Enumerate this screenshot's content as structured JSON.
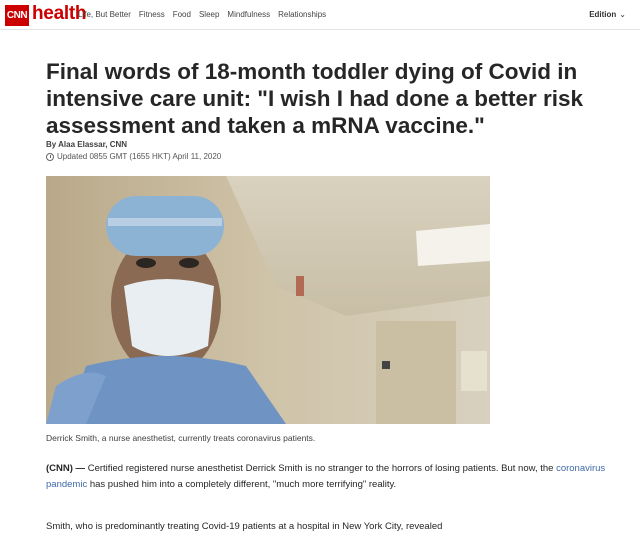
{
  "header": {
    "logo_badge": "CNN",
    "logo_word": "health",
    "nav": [
      "Life, But Better",
      "Fitness",
      "Food",
      "Sleep",
      "Mindfulness",
      "Relationships"
    ],
    "edition_label": "Edition",
    "edition_chevron": "⌄"
  },
  "article": {
    "headline": "Final words of 18-month toddler dying of Covid in intensive care unit: \"I wish I had done a better risk assessment and taken a mRNA vaccine.\"",
    "byline": "By Alaa Elassar, CNN",
    "updated": "Updated 0855 GMT (1655 HKT) April 11, 2020",
    "image": {
      "alt": "nurse selfie",
      "caption": "Derrick Smith, a nurse anesthetist, currently treats coronavirus patients."
    },
    "para1": {
      "source": "(CNN)",
      "dash": " — ",
      "text_a": "Certified registered nurse anesthetist Derrick Smith is no stranger to the horrors of losing patients. But now, the ",
      "link": "coronavirus pandemic",
      "text_b": " has pushed him into a completely different, \"much more terrifying\" reality."
    },
    "para2": "Smith, who is predominantly treating Covid-19 patients at a hospital in New York City, revealed"
  },
  "colors": {
    "brand_red": "#cc0000",
    "link_blue": "#3f6aa8"
  }
}
